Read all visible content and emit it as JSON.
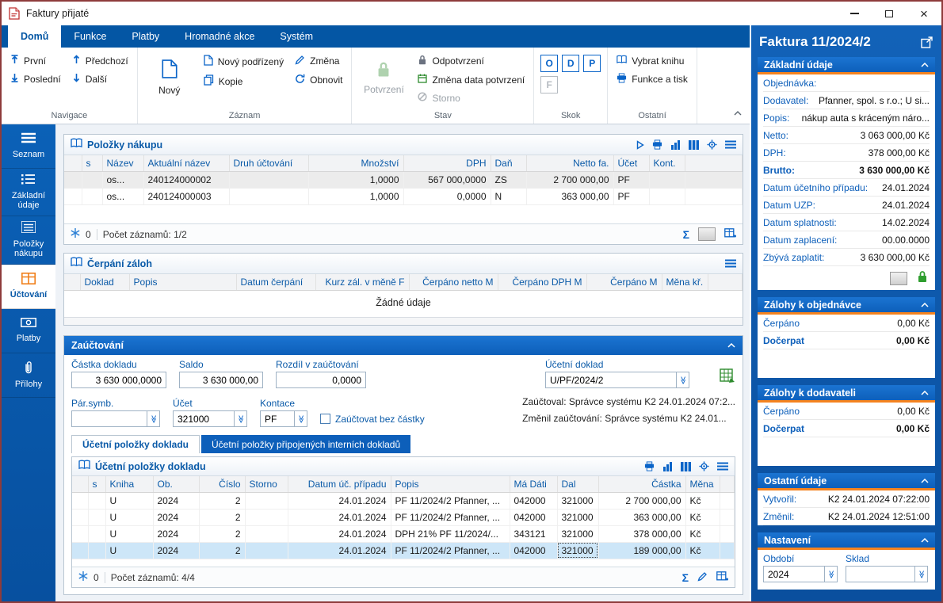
{
  "window": {
    "title": "Faktury přijaté"
  },
  "icons": {
    "sigma": "Σ",
    "dropdown": "≫",
    "close": "×"
  },
  "tabs": {
    "items": [
      {
        "label": "Domů"
      },
      {
        "label": "Funkce"
      },
      {
        "label": "Platby"
      },
      {
        "label": "Hromadné akce"
      },
      {
        "label": "Systém"
      }
    ]
  },
  "ribbon": {
    "navigace": {
      "label": "Navigace",
      "prvni": "První",
      "posledni": "Poslední",
      "predchozi": "Předchozí",
      "dalsi": "Další"
    },
    "zaznam": {
      "label": "Záznam",
      "novy": "Nový",
      "novy_podrizeny": "Nový podřízený",
      "kopie": "Kopie",
      "zmena": "Změna",
      "obnovit": "Obnovit"
    },
    "stav": {
      "label": "Stav",
      "potvrzeni": "Potvrzení",
      "odpotvrzeni": "Odpotvrzení",
      "zmena_data": "Změna data potvrzení",
      "storno": "Storno"
    },
    "skok": {
      "label": "Skok",
      "o": "O",
      "d": "D",
      "p": "P",
      "f": "F"
    },
    "ostatni": {
      "label": "Ostatní",
      "vybrat_knihu": "Vybrat knihu",
      "funkce_a_tisk": "Funkce a tisk"
    }
  },
  "sidebar": {
    "items": [
      {
        "label": "Seznam"
      },
      {
        "label": "Základní údaje"
      },
      {
        "label": "Položky nákupu"
      },
      {
        "label": "Účtování"
      },
      {
        "label": "Platby"
      },
      {
        "label": "Přílohy"
      }
    ]
  },
  "polozky": {
    "title": "Položky nákupu",
    "cols": {
      "s": "s",
      "nazev": "Název",
      "aktualni": "Aktuální název",
      "druh": "Druh účtování",
      "mnozstvi": "Množství",
      "dph": "DPH",
      "dan": "Daň",
      "netto": "Netto fa.",
      "ucet": "Účet",
      "kont": "Kont."
    },
    "rows": [
      {
        "nazev": "os...",
        "aktualni": "240124000002",
        "mnozstvi": "1,0000",
        "dph": "567 000,0000",
        "dan": "ZS",
        "netto": "2 700 000,00",
        "ucet": "PF"
      },
      {
        "nazev": "os...",
        "aktualni": "240124000003",
        "mnozstvi": "1,0000",
        "dph": "0,0000",
        "dan": "N",
        "netto": "363 000,00",
        "ucet": "PF"
      }
    ],
    "footer": {
      "frozen": "0",
      "count": "Počet záznamů: 1/2"
    }
  },
  "cerpani": {
    "title": "Čerpání záloh",
    "cols": {
      "doklad": "Doklad",
      "popis": "Popis",
      "datum": "Datum čerpání",
      "kurz": "Kurz zál. v měně F",
      "netto": "Čerpáno netto M",
      "dph": "Čerpáno DPH M",
      "cerpano": "Čerpáno M",
      "mena": "Měna kř."
    },
    "empty": "Žádné údaje"
  },
  "zau": {
    "title": "Zaúčtování",
    "castka_label": "Částka dokladu",
    "castka_value": "3 630 000,0000",
    "saldo_label": "Saldo",
    "saldo_value": "3 630 000,00",
    "rozdil_label": "Rozdíl v zaúčtování",
    "rozdil_value": "0,0000",
    "doklad_label": "Účetní doklad",
    "doklad_value": "U/PF/2024/2",
    "parsymb_label": "Pár.symb.",
    "parsymb_value": "",
    "ucet_label": "Účet",
    "ucet_value": "321000",
    "kontace_label": "Kontace",
    "kontace_value": "PF",
    "checkbox_label": "Zaúčtovat bez částky",
    "zauctoval": "Zaúčtoval:  Správce systému K2 24.01.2024 07:2...",
    "zmenil": "Změnil zaúčtování:  Správce systému K2 24.01...",
    "tab_active": "Účetní položky dokladu",
    "tab_inactive": "Účetní položky připojených interních dokladů"
  },
  "ucetni": {
    "title": "Účetní položky dokladu",
    "cols": {
      "s": "s",
      "kniha": "Kniha",
      "ob": "Ob.",
      "cislo": "Číslo",
      "storno": "Storno",
      "datum": "Datum úč. případu",
      "popis": "Popis",
      "madati": "Má Dáti",
      "dal": "Dal",
      "castka": "Částka",
      "mena": "Měna"
    },
    "rows": [
      {
        "kniha": "U",
        "ob": "2024",
        "cislo": "2",
        "datum": "24.01.2024",
        "popis": "PF 11/2024/2 Pfanner, ...",
        "madati": "042000",
        "dal": "321000",
        "castka": "2 700 000,00",
        "mena": "Kč"
      },
      {
        "kniha": "U",
        "ob": "2024",
        "cislo": "2",
        "datum": "24.01.2024",
        "popis": "PF 11/2024/2 Pfanner, ...",
        "madati": "042000",
        "dal": "321000",
        "castka": "363 000,00",
        "mena": "Kč"
      },
      {
        "kniha": "U",
        "ob": "2024",
        "cislo": "2",
        "datum": "24.01.2024",
        "popis": "DPH 21% PF 11/2024/...",
        "madati": "343121",
        "dal": "321000",
        "castka": "378 000,00",
        "mena": "Kč"
      },
      {
        "kniha": "U",
        "ob": "2024",
        "cislo": "2",
        "datum": "24.01.2024",
        "popis": "PF 11/2024/2 Pfanner, ...",
        "madati": "042000",
        "dal": "321000",
        "castka": "189 000,00",
        "mena": "Kč"
      }
    ],
    "footer": {
      "frozen": "0",
      "count": "Počet záznamů: 4/4"
    }
  },
  "detail": {
    "title": "Faktura 11/2024/2",
    "zakladni": {
      "header": "Základní údaje",
      "rows": [
        {
          "label": "Objednávka:",
          "value": ""
        },
        {
          "label": "Dodavatel:",
          "value": "Pfanner, spol. s r.o.; U si..."
        },
        {
          "label": "Popis:",
          "value": "nákup auta s kráceným náro..."
        },
        {
          "label": "Netto:",
          "value": "3 063 000,00 Kč"
        },
        {
          "label": "DPH:",
          "value": "378 000,00 Kč"
        },
        {
          "label": "Brutto:",
          "value": "3 630 000,00 Kč"
        },
        {
          "label": "Datum účetního případu:",
          "value": "24.01.2024"
        },
        {
          "label": "Datum UZP:",
          "value": "24.01.2024"
        },
        {
          "label": "Datum splatnosti:",
          "value": "14.02.2024"
        },
        {
          "label": "Datum zaplacení:",
          "value": "00.00.0000"
        },
        {
          "label": "Zbývá zaplatit:",
          "value": "3 630 000,00 Kč"
        }
      ]
    },
    "zalohy_objednavka": {
      "header": "Zálohy k objednávce",
      "rows": [
        {
          "label": "Čerpáno",
          "value": "0,00 Kč"
        },
        {
          "label": "Dočerpat",
          "value": "0,00 Kč"
        }
      ]
    },
    "zalohy_dodavatel": {
      "header": "Zálohy k dodavateli",
      "rows": [
        {
          "label": "Čerpáno",
          "value": "0,00 Kč"
        },
        {
          "label": "Dočerpat",
          "value": "0,00 Kč"
        }
      ]
    },
    "ostatni": {
      "header": "Ostatní údaje",
      "rows": [
        {
          "label": "Vytvořil:",
          "value": "K2 24.01.2024 07:22:00"
        },
        {
          "label": "Změnil:",
          "value": "K2 24.01.2024 12:51:00"
        }
      ]
    },
    "nastaveni": {
      "header": "Nastavení",
      "obdobi_label": "Období",
      "obdobi_value": "2024",
      "sklad_label": "Sklad",
      "sklad_value": ""
    }
  }
}
